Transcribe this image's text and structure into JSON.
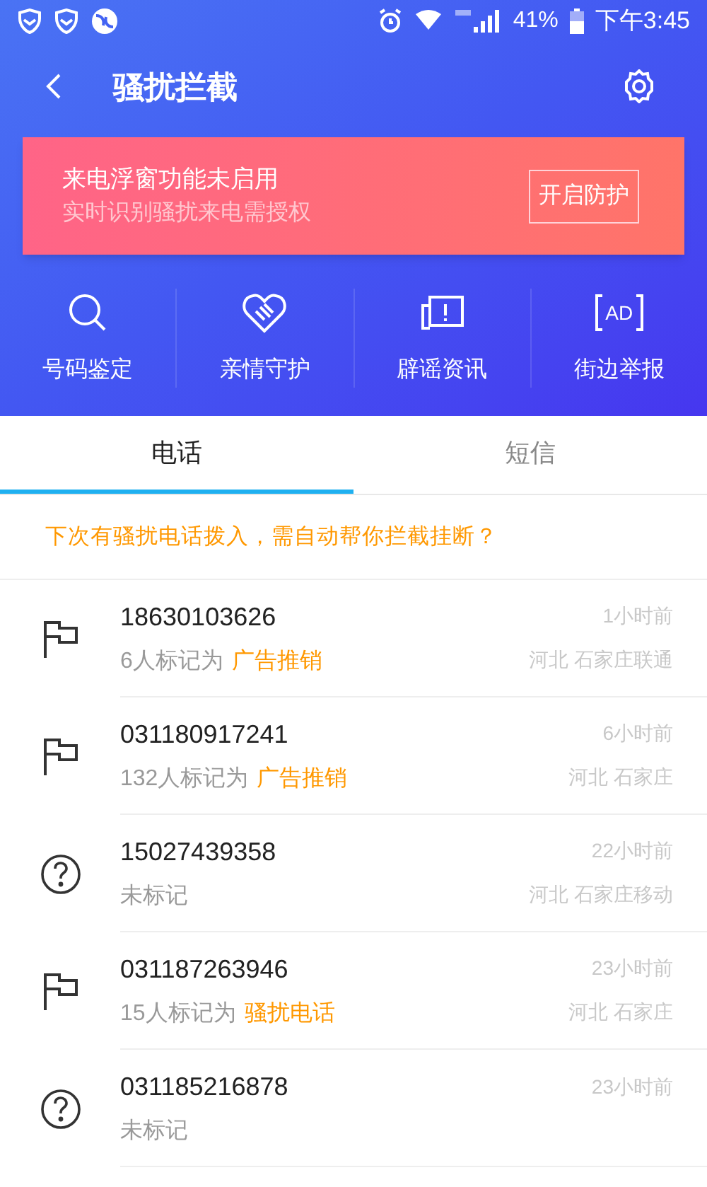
{
  "status_bar": {
    "battery": "41%",
    "time": "下午3:45"
  },
  "header": {
    "title": "骚扰拦截"
  },
  "banner": {
    "title": "来电浮窗功能未启用",
    "subtitle": "实时识别骚扰来电需授权",
    "button": "开启防护"
  },
  "actions": [
    {
      "kind": "search",
      "label": "号码鉴定"
    },
    {
      "kind": "heart",
      "label": "亲情守护"
    },
    {
      "kind": "notice",
      "label": "辟谣资讯"
    },
    {
      "kind": "ad",
      "label": "街边举报",
      "icon_text": "AD"
    }
  ],
  "tabs": [
    {
      "label": "电话",
      "selected": true
    },
    {
      "label": "短信",
      "selected": false
    }
  ],
  "prompt": "下次有骚扰电话拨入，需自动帮你拦截挂断？",
  "calls": [
    {
      "kind": "flag",
      "number": "18630103626",
      "count": "6人标记为",
      "tag": "广告推销",
      "time": "1小时前",
      "location": "河北 石家庄联通"
    },
    {
      "kind": "flag",
      "number": "031180917241",
      "count": "132人标记为",
      "tag": "广告推销",
      "time": "6小时前",
      "location": "河北 石家庄"
    },
    {
      "kind": "unknown",
      "number": "15027439358",
      "count": "未标记",
      "time": "22小时前",
      "location": "河北 石家庄移动"
    },
    {
      "kind": "flag",
      "number": "031187263946",
      "count": "15人标记为",
      "tag": "骚扰电话",
      "time": "23小时前",
      "location": "河北 石家庄"
    },
    {
      "kind": "unknown",
      "number": "031185216878",
      "count": "未标记",
      "time": "23小时前"
    }
  ]
}
